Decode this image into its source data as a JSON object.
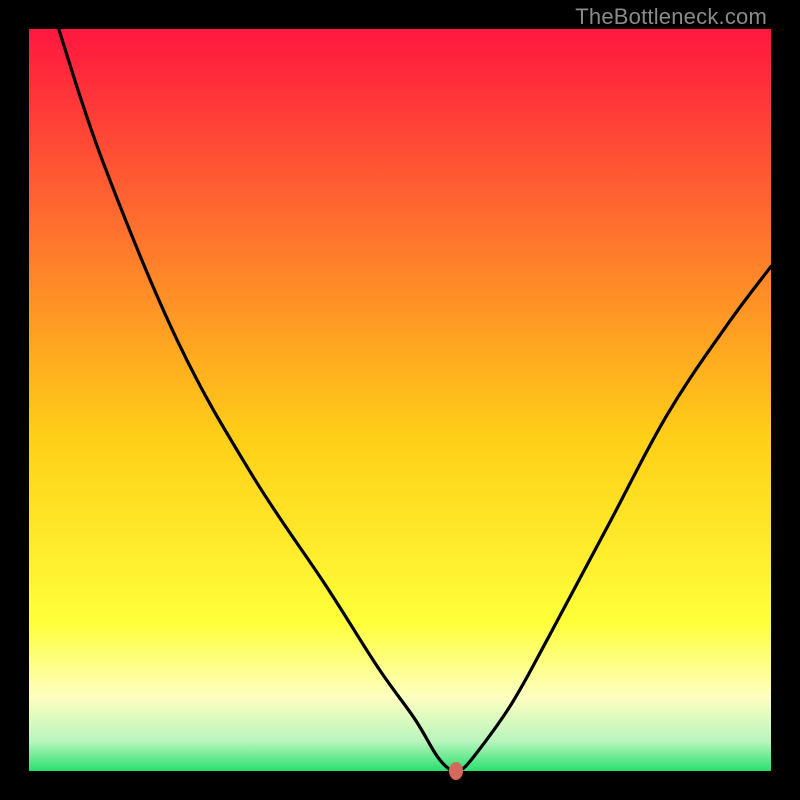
{
  "watermark": "TheBottleneck.com",
  "colors": {
    "bg": "#000000",
    "grad_top": "#ff173f",
    "grad_upper": "#ff5a33",
    "grad_mid": "#ffab1f",
    "grad_yellow": "#ffe714",
    "grad_pale": "#feffb4",
    "grad_green_light": "#8ff29a",
    "grad_green": "#29e06e",
    "curve": "#000000",
    "marker": "#d46a5f"
  },
  "chart_data": {
    "type": "line",
    "title": "",
    "xlabel": "",
    "ylabel": "",
    "xlim": [
      0,
      100
    ],
    "ylim": [
      0,
      100
    ],
    "series": [
      {
        "name": "bottleneck-curve",
        "x": [
          4,
          10,
          20,
          30,
          40,
          47,
          52,
          55,
          57,
          58,
          60,
          65,
          70,
          78,
          86,
          94,
          100
        ],
        "y": [
          100,
          82,
          58,
          40,
          25,
          14,
          7,
          2,
          0,
          0,
          2,
          9,
          18,
          33,
          48,
          60,
          68
        ]
      }
    ],
    "marker": {
      "x": 57.5,
      "y": 0
    },
    "gradient_stops": [
      {
        "pct": 0,
        "hex": "#ff173f"
      },
      {
        "pct": 25,
        "hex": "#ff6a2f"
      },
      {
        "pct": 55,
        "hex": "#ffcf17"
      },
      {
        "pct": 80,
        "hex": "#ffff3a"
      },
      {
        "pct": 90,
        "hex": "#feffc0"
      },
      {
        "pct": 96,
        "hex": "#b8f5bd"
      },
      {
        "pct": 100,
        "hex": "#29e06e"
      }
    ]
  }
}
